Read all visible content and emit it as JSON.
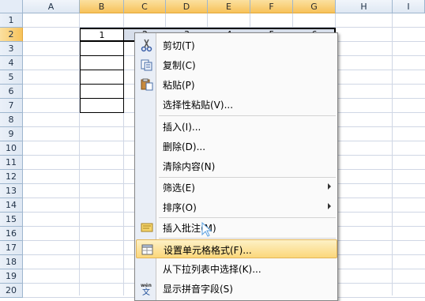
{
  "sheet": {
    "columns": [
      "A",
      "B",
      "C",
      "D",
      "E",
      "F",
      "G",
      "H",
      "I"
    ],
    "rows": [
      "1",
      "2",
      "3",
      "4",
      "5",
      "6",
      "7",
      "8",
      "9",
      "10",
      "11",
      "12",
      "13",
      "14",
      "15",
      "16",
      "17",
      "18",
      "19",
      "20"
    ],
    "cell_b2": "1",
    "cell_c2": "2",
    "cell_d2": "3",
    "cell_e2": "4",
    "cell_f2": "5",
    "cell_g2": "6"
  },
  "context_menu": {
    "items": [
      {
        "label": "剪切(T)",
        "icon": "scissors-icon"
      },
      {
        "label": "复制(C)",
        "icon": "copy-icon"
      },
      {
        "label": "粘贴(P)",
        "icon": "paste-icon"
      },
      {
        "label": "选择性粘贴(V)..."
      },
      {
        "label": "插入(I)..."
      },
      {
        "label": "删除(D)..."
      },
      {
        "label": "清除内容(N)"
      },
      {
        "label": "筛选(E)",
        "submenu": true
      },
      {
        "label": "排序(O)",
        "submenu": true
      },
      {
        "label": "插入批注(M)",
        "icon": "comment-icon"
      },
      {
        "label": "设置单元格格式(F)...",
        "icon": "format-cells-icon",
        "highlighted": true
      },
      {
        "label": "从下拉列表中选择(K)..."
      },
      {
        "label": "显示拼音字段(S)",
        "icon": "phonetic-icon"
      }
    ]
  },
  "colors": {
    "selected_header": "#f7c25a",
    "menu_highlight": "#fbd77b",
    "grid": "#d0d7e5"
  }
}
